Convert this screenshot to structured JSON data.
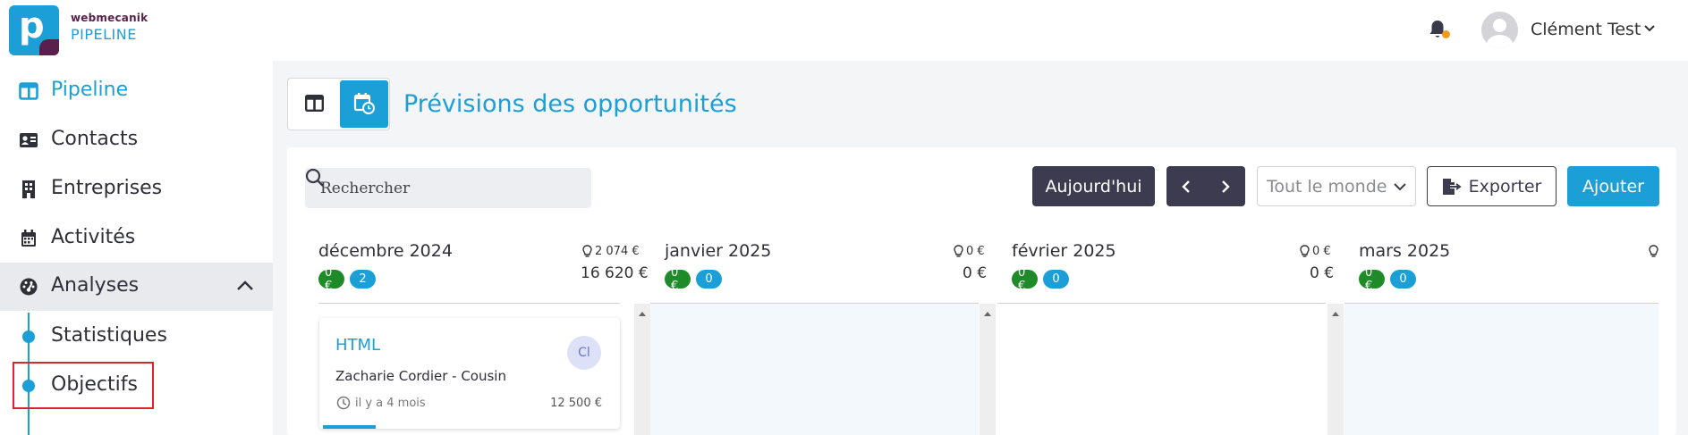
{
  "brand": {
    "top": "webmecanik",
    "bottom": "PIPELINE"
  },
  "user": {
    "name": "Clément Test"
  },
  "sidebar": {
    "items": [
      {
        "label": "Pipeline",
        "icon": "layout-icon",
        "active": true
      },
      {
        "label": "Contacts",
        "icon": "contact-card-icon"
      },
      {
        "label": "Entreprises",
        "icon": "building-icon"
      },
      {
        "label": "Activités",
        "icon": "calendar-icon"
      },
      {
        "label": "Analyses",
        "icon": "gauge-icon",
        "expanded": true
      }
    ],
    "sub_items": [
      {
        "label": "Statistiques"
      },
      {
        "label": "Objectifs"
      }
    ]
  },
  "page": {
    "title": "Prévisions des opportunités"
  },
  "toolbar": {
    "search_placeholder": "Rechercher",
    "today_label": "Aujourd'hui",
    "owner_filter": "Tout le monde",
    "export_label": "Exporter",
    "add_label": "Ajouter"
  },
  "months": [
    {
      "name": "décembre 2024",
      "amount_badge": "0 €",
      "count_badge": "2",
      "potential": "2 074 €",
      "total": "16 620 €"
    },
    {
      "name": "janvier 2025",
      "amount_badge": "0 €",
      "count_badge": "0",
      "potential": "0 €",
      "total": "0 €"
    },
    {
      "name": "février 2025",
      "amount_badge": "0 €",
      "count_badge": "0",
      "potential": "0 €",
      "total": "0 €"
    },
    {
      "name": "mars 2025",
      "amount_badge": "0 €",
      "count_badge": "0",
      "potential": "",
      "total": ""
    }
  ],
  "opportunity": {
    "title": "HTML",
    "initials": "Cl",
    "company": "Zacharie Cordier - Cousin",
    "time": "il y a 4 mois",
    "amount": "12 500 €",
    "progress": 0.18
  },
  "colors": {
    "accent": "#1c9fd6",
    "dark": "#3d3b50",
    "brand_purple": "#5a1f4c",
    "green": "#1f8a28",
    "notification": "#f29b1b",
    "highlight": "#d9262c"
  }
}
